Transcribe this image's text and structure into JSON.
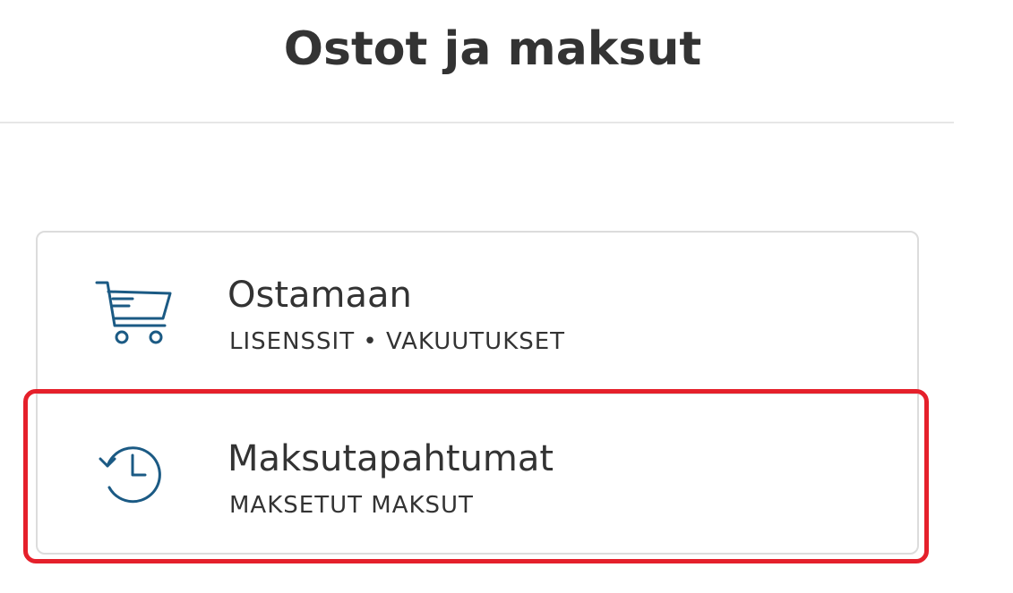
{
  "header": {
    "title": "Ostot ja maksut"
  },
  "menu": {
    "items": [
      {
        "title": "Ostamaan",
        "subtitle": "LISENSSIT • VAKUUTUKSET",
        "icon": "shopping-cart-icon"
      },
      {
        "title": "Maksutapahtumat",
        "subtitle": "MAKSETUT MAKSUT",
        "icon": "history-clock-icon"
      }
    ]
  },
  "colors": {
    "icon": "#1b5a84",
    "text": "#333333",
    "highlight": "#e5202b",
    "border": "#dcdcdc"
  }
}
